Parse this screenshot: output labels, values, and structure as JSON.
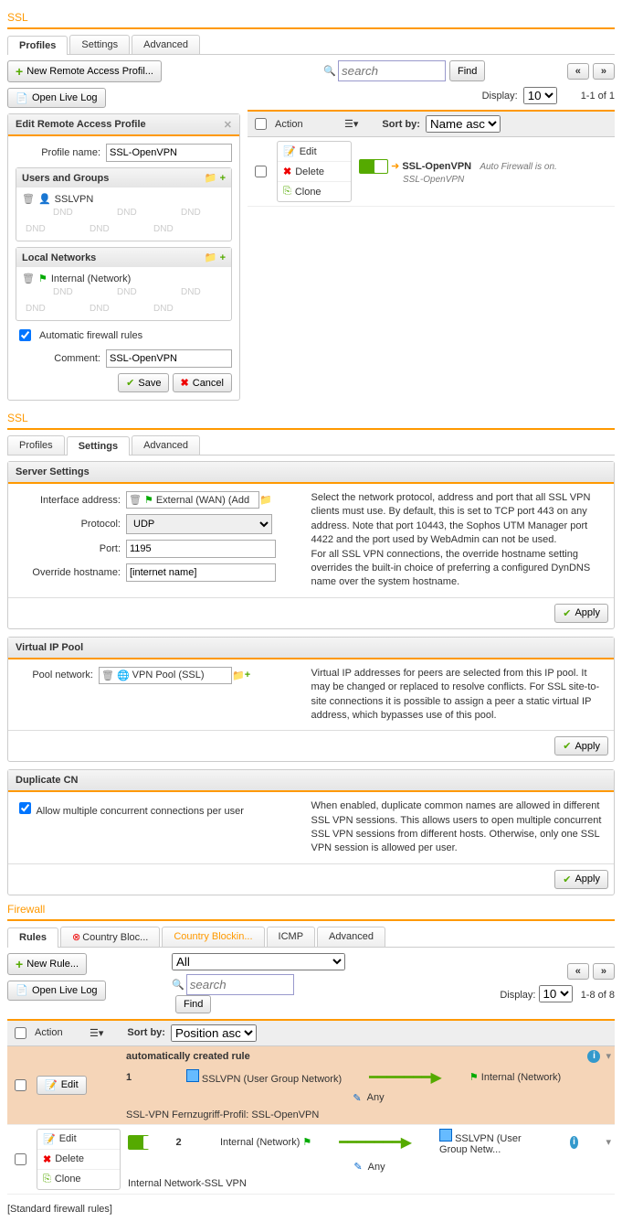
{
  "ssl": {
    "title": "SSL",
    "tabs": [
      "Profiles",
      "Settings",
      "Advanced"
    ],
    "new_profile": "New Remote Access Profil...",
    "open_log": "Open Live Log",
    "search_ph": "search",
    "find": "Find",
    "display": "Display:",
    "display_val": "10",
    "count": "1-1 of 1",
    "edit_panel": {
      "title": "Edit Remote Access Profile",
      "profile_name_l": "Profile name:",
      "profile_name": "SSL-OpenVPN",
      "ug": "Users and Groups",
      "ug_item": "SSLVPN",
      "ln": "Local Networks",
      "ln_item": "Internal (Network)",
      "auto_fw": "Automatic firewall rules",
      "comment_l": "Comment:",
      "comment": "SSL-OpenVPN",
      "save": "Save",
      "cancel": "Cancel"
    },
    "list": {
      "action": "Action",
      "sort_l": "Sort by:",
      "sort_v": "Name asc",
      "edit": "Edit",
      "delete": "Delete",
      "clone": "Clone",
      "name": "SSL-OpenVPN",
      "sub": "SSL-OpenVPN",
      "status": "Auto Firewall is on."
    }
  },
  "settings": {
    "title": "SSL",
    "tabs": [
      "Profiles",
      "Settings",
      "Advanced"
    ],
    "server": {
      "title": "Server Settings",
      "iface_l": "Interface address:",
      "iface_v": "External (WAN) (Add",
      "proto_l": "Protocol:",
      "proto_v": "UDP",
      "port_l": "Port:",
      "port_v": "1195",
      "oh_l": "Override hostname:",
      "oh_v": "[internet name]",
      "apply": "Apply",
      "help1": "Select the network protocol, address and port that all SSL VPN clients must use. By default, this is set to TCP port 443 on any address. Note that port 10443, the Sophos UTM Manager port 4422 and the port used by WebAdmin can not be used.",
      "help2": "For all SSL VPN connections, the override hostname setting overrides the built-in choice of preferring a configured DynDNS name over the system hostname."
    },
    "vip": {
      "title": "Virtual IP Pool",
      "pool_l": "Pool network:",
      "pool_v": "VPN Pool (SSL)",
      "help": "Virtual IP addresses for peers are selected from this IP pool. It may be changed or replaced to resolve conflicts. For SSL site-to-site connections it is possible to assign a peer a static virtual IP address, which bypasses use of this pool."
    },
    "dup": {
      "title": "Duplicate CN",
      "cb": "Allow multiple concurrent connections per user",
      "help": "When enabled, duplicate common names are allowed in different SSL VPN sessions. This allows users to open multiple concurrent SSL VPN sessions from different hosts. Otherwise, only one SSL VPN session is allowed per user."
    }
  },
  "firewall": {
    "title": "Firewall",
    "tabs": [
      "Rules",
      "Country Bloc...",
      "Country Blockin...",
      "ICMP",
      "Advanced"
    ],
    "new_rule": "New Rule...",
    "open_log": "Open Live Log",
    "all": "All",
    "search_ph": "search",
    "find": "Find",
    "display": "Display:",
    "display_val": "10",
    "count": "1-8 of 8",
    "list": {
      "action": "Action",
      "sort_l": "Sort by:",
      "sort_v": "Position asc",
      "edit": "Edit",
      "delete": "Delete",
      "clone": "Clone",
      "r1": {
        "pos": "1",
        "name": "automatically created rule",
        "src": "SSLVPN (User Group Network)",
        "svc": "Any",
        "dst": "Internal (Network)",
        "note": "SSL-VPN Fernzugriff-Profil: SSL-OpenVPN"
      },
      "r2": {
        "pos": "2",
        "src": "Internal (Network)",
        "svc": "Any",
        "dst": "SSLVPN (User Group Netw...",
        "note": "Internal Network-SSL VPN"
      }
    },
    "footer": "[Standard firewall rules]"
  }
}
